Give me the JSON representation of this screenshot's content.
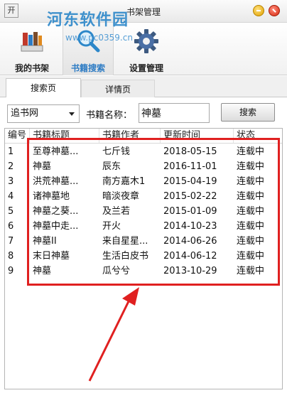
{
  "window": {
    "title": "书架管理",
    "app_icon": "开"
  },
  "watermark": {
    "text": "河东软件园",
    "url": "www.pc0359.cn"
  },
  "toolbar": [
    {
      "label": "我的书架",
      "icon": "bookshelf-icon"
    },
    {
      "label": "书籍搜索",
      "icon": "search-icon"
    },
    {
      "label": "设置管理",
      "icon": "gear-icon"
    }
  ],
  "tabs": {
    "search": "搜索页",
    "detail": "详情页"
  },
  "search": {
    "source_selected": "追书网",
    "name_label": "书籍名称：",
    "name_value": "神墓",
    "button_label": "搜索"
  },
  "table": {
    "headers": [
      "编号",
      "书籍标题",
      "书籍作者",
      "更新时间",
      "状态"
    ],
    "rows": [
      [
        "1",
        "至尊神墓...",
        "七斤钱",
        "2018-05-15",
        "连载中"
      ],
      [
        "2",
        "神墓",
        "辰东",
        "2016-11-01",
        "连载中"
      ],
      [
        "3",
        "洪荒神墓...",
        "南方嘉木1",
        "2015-04-19",
        "连载中"
      ],
      [
        "4",
        "诸神墓地",
        "暗淡夜章",
        "2015-02-22",
        "连载中"
      ],
      [
        "5",
        "神墓之葵...",
        "及兰若",
        "2015-01-09",
        "连载中"
      ],
      [
        "6",
        "神墓中走...",
        "开火",
        "2014-10-23",
        "连载中"
      ],
      [
        "7",
        "神墓II",
        "来自星星...",
        "2014-06-26",
        "连载中"
      ],
      [
        "8",
        "末日神墓",
        "生活白皮书",
        "2014-06-12",
        "连载中"
      ],
      [
        "9",
        "神墓",
        "瓜兮兮",
        "2013-10-29",
        "连载中"
      ]
    ]
  },
  "colors": {
    "accent": "#2c7bc4",
    "highlight": "#e02020",
    "close": "#d62a10",
    "minimize": "#e0a000"
  }
}
